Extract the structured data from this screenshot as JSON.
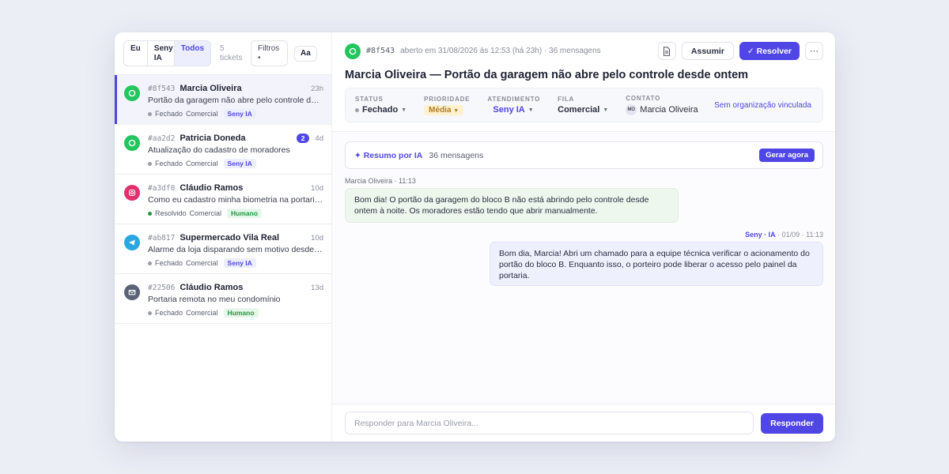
{
  "colors": {
    "accent": "#4f46e5",
    "whatsapp": "#22c55e",
    "instagram": "#e1306c",
    "telegram": "#2aa7e0",
    "email": "#5b6275",
    "closed": "#9a9daa",
    "resolved": "#22963f"
  },
  "filters": {
    "tab_me": "Eu",
    "tab_seny": "Seny IA",
    "tab_all": "Todos",
    "count": "5 tickets",
    "filters_label": "Filtros •",
    "font_label": "Aa"
  },
  "tickets": [
    {
      "id": "#8f543",
      "name": "Marcia Oliveira",
      "age": "23h",
      "subject": "Portão da garagem não abre pelo controle desde ontem",
      "status": "Fechado",
      "queue": "Comercial",
      "tag": "Seny IA",
      "channel": "whatsapp-icon"
    },
    {
      "id": "#aa2d2",
      "name": "Patricia Doneda",
      "unread": "2",
      "age": "4d",
      "subject": "Atualização do cadastro de moradores",
      "status": "Fechado",
      "queue": "Comercial",
      "tag": "Seny IA",
      "channel": "whatsapp-icon"
    },
    {
      "id": "#a3df0",
      "name": "Cláudio Ramos",
      "age": "10d",
      "subject": "Como eu cadastro minha biometria na portaria?",
      "status": "Resolvido",
      "queue": "Comercial",
      "tag": "Humano",
      "channel": "instagram-icon"
    },
    {
      "id": "#ab817",
      "name": "Supermercado Vila Real",
      "age": "10d",
      "subject": "Alarme da loja disparando sem motivo desde ontem",
      "status": "Fechado",
      "queue": "Comercial",
      "tag": "Seny IA",
      "channel": "telegram-icon"
    },
    {
      "id": "#22506",
      "name": "Cláudio Ramos",
      "age": "13d",
      "subject": "Portaria remota no meu condomínio",
      "status": "Fechado",
      "queue": "Comercial",
      "tag": "Humano",
      "channel": "email-icon"
    }
  ],
  "header": {
    "id": "#8f543",
    "meta": "aberto em 31/08/2026 às 12:53 (há 23h) · 36 mensagens",
    "assumir": "Assumir",
    "resolver": "✓ Resolver",
    "more": "⋯",
    "title": "Marcia Oliveira — Portão da garagem não abre pelo controle desde ontem"
  },
  "props": {
    "status_label": "STATUS",
    "status_value": "Fechado",
    "prio_label": "PRIORIDADE",
    "prio_value": "Média",
    "atend_label": "ATENDIMENTO",
    "atend_value": "Seny IA",
    "fila_label": "FILA",
    "fila_value": "Comercial",
    "contato_label": "CONTATO",
    "contato_initials": "MO",
    "contato_value": "Marcia Oliveira",
    "org_link": "Sem organização vinculada"
  },
  "summary": {
    "title": "✦ Resumo por IA",
    "count": "36 mensagens",
    "button": "Gerar agora"
  },
  "messages": {
    "in_meta": "Marcia Oliveira · 11:13",
    "in_text": "Bom dia! O portão da garagem do bloco B não está abrindo pelo controle desde ontem à noite. Os moradores estão tendo que abrir manualmente.",
    "out_sender": "Seny · IA",
    "out_time": " · 01/09 · 11:13",
    "out_text": "Bom dia, Marcia! Abri um chamado para a equipe técnica verificar o acionamento do portão do bloco B. Enquanto isso, o porteiro pode liberar o acesso pelo painel da portaria."
  },
  "reply": {
    "placeholder": "Responder para Marcia Oliveira...",
    "button": "Responder"
  }
}
